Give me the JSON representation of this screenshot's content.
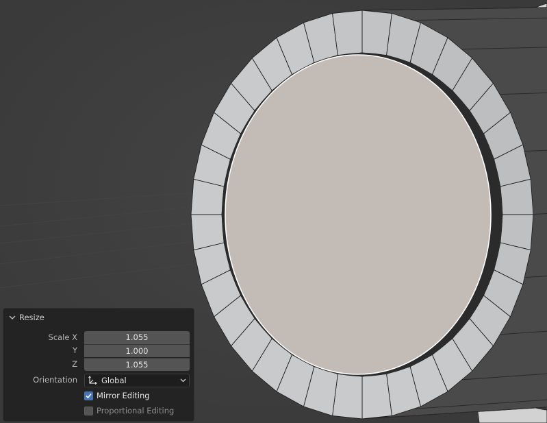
{
  "viewport": {
    "background": "#3d3d3d",
    "face_color": "#c3bbb5",
    "ring_color": "#c5c7c8",
    "edge_color": "#202020",
    "selected_edge_color": "#ffffff"
  },
  "operator_panel": {
    "title": "Resize",
    "collapse_icon": "chevron-down-icon",
    "scale_label": "Scale X",
    "y_label": "Y",
    "z_label": "Z",
    "scale_x": "1.055",
    "scale_y": "1.000",
    "scale_z": "1.055",
    "orientation_label": "Orientation",
    "orientation_value": "Global",
    "orientation_icon": "transform-axes-icon",
    "mirror_editing_label": "Mirror Editing",
    "mirror_editing_checked": true,
    "proportional_editing_label": "Proportional Editing",
    "proportional_editing_checked": false,
    "accent_color": "#4772b3"
  }
}
